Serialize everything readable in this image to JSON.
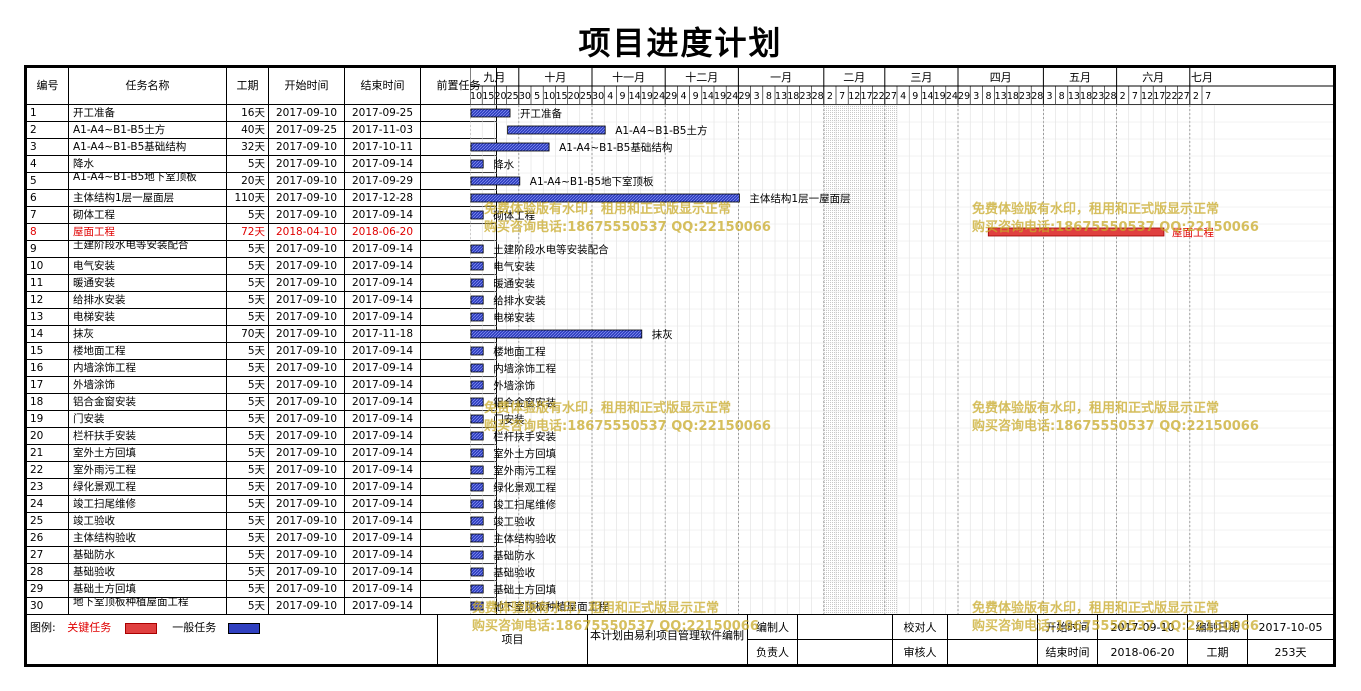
{
  "title": "项目进度计划",
  "headers": {
    "id": "编号",
    "name": "任务名称",
    "duration": "工期",
    "start": "开始时间",
    "end": "结束时间",
    "predecessor": "前置任务"
  },
  "colors": {
    "critical": "#e04040",
    "normal": "#3040c0",
    "critical_text": "#e00000"
  },
  "timeline": {
    "origin": "2017-09-10",
    "months": [
      {
        "label": "九月",
        "days": [
          "10",
          "15",
          "20",
          "25"
        ]
      },
      {
        "label": "十月",
        "days": [
          "30",
          "5",
          "10",
          "15",
          "20",
          "25"
        ]
      },
      {
        "label": "十一月",
        "days": [
          "30",
          "4",
          "9",
          "14",
          "19",
          "24"
        ]
      },
      {
        "label": "十二月",
        "days": [
          "29",
          "4",
          "9",
          "14",
          "19",
          "24"
        ]
      },
      {
        "label": "一月",
        "days": [
          "29",
          "3",
          "8",
          "13",
          "18",
          "23",
          "28"
        ]
      },
      {
        "label": "二月",
        "days": [
          "2",
          "7",
          "12",
          "17",
          "22"
        ]
      },
      {
        "label": "三月",
        "days": [
          "27",
          "4",
          "9",
          "14",
          "19",
          "24"
        ]
      },
      {
        "label": "四月",
        "days": [
          "29",
          "3",
          "8",
          "13",
          "18",
          "23",
          "28"
        ]
      },
      {
        "label": "五月",
        "days": [
          "3",
          "8",
          "13",
          "18",
          "23",
          "28"
        ]
      },
      {
        "label": "六月",
        "days": [
          "2",
          "7",
          "12",
          "17",
          "22",
          "27"
        ]
      },
      {
        "label": "七月",
        "days": [
          "2",
          "7"
        ]
      }
    ]
  },
  "tasks": [
    {
      "id": "1",
      "name": "开工准备",
      "duration": "16天",
      "start": "2017-09-10",
      "end": "2017-09-25",
      "bar_label": "开工准备",
      "critical": false,
      "two_line": false
    },
    {
      "id": "2",
      "name": "A1-A4~B1-B5土方",
      "duration": "40天",
      "start": "2017-09-25",
      "end": "2017-11-03",
      "bar_label": "A1-A4~B1-B5土方",
      "critical": false,
      "two_line": false
    },
    {
      "id": "3",
      "name": "A1-A4~B1-B5基础结构",
      "duration": "32天",
      "start": "2017-09-10",
      "end": "2017-10-11",
      "bar_label": "A1-A4~B1-B5基础结构",
      "critical": false,
      "two_line": false
    },
    {
      "id": "4",
      "name": "降水",
      "duration": "5天",
      "start": "2017-09-10",
      "end": "2017-09-14",
      "bar_label": "降水",
      "critical": false,
      "two_line": false
    },
    {
      "id": "5",
      "name": "A1-A4~B1-B5地下室顶板",
      "duration": "20天",
      "start": "2017-09-10",
      "end": "2017-09-29",
      "bar_label": "A1-A4~B1-B5地下室顶板",
      "critical": false,
      "two_line": true
    },
    {
      "id": "6",
      "name": "主体结构1层一屋面层",
      "duration": "110天",
      "start": "2017-09-10",
      "end": "2017-12-28",
      "bar_label": "主体结构1层一屋面层",
      "critical": false,
      "two_line": false
    },
    {
      "id": "7",
      "name": "砌体工程",
      "duration": "5天",
      "start": "2017-09-10",
      "end": "2017-09-14",
      "bar_label": "砌体工程",
      "critical": false,
      "two_line": false
    },
    {
      "id": "8",
      "name": "屋面工程",
      "duration": "72天",
      "start": "2018-04-10",
      "end": "2018-06-20",
      "bar_label": "屋面工程",
      "critical": true,
      "two_line": false
    },
    {
      "id": "9",
      "name": "土建阶段水电等安装配合",
      "duration": "5天",
      "start": "2017-09-10",
      "end": "2017-09-14",
      "bar_label": "土建阶段水电等安装配合",
      "critical": false,
      "two_line": true
    },
    {
      "id": "10",
      "name": "电气安装",
      "duration": "5天",
      "start": "2017-09-10",
      "end": "2017-09-14",
      "bar_label": "电气安装",
      "critical": false,
      "two_line": false
    },
    {
      "id": "11",
      "name": "暖通安装",
      "duration": "5天",
      "start": "2017-09-10",
      "end": "2017-09-14",
      "bar_label": "暖通安装",
      "critical": false,
      "two_line": false
    },
    {
      "id": "12",
      "name": "给排水安装",
      "duration": "5天",
      "start": "2017-09-10",
      "end": "2017-09-14",
      "bar_label": "给排水安装",
      "critical": false,
      "two_line": false
    },
    {
      "id": "13",
      "name": "电梯安装",
      "duration": "5天",
      "start": "2017-09-10",
      "end": "2017-09-14",
      "bar_label": "电梯安装",
      "critical": false,
      "two_line": false
    },
    {
      "id": "14",
      "name": "抹灰",
      "duration": "70天",
      "start": "2017-09-10",
      "end": "2017-11-18",
      "bar_label": "抹灰",
      "critical": false,
      "two_line": false
    },
    {
      "id": "15",
      "name": "楼地面工程",
      "duration": "5天",
      "start": "2017-09-10",
      "end": "2017-09-14",
      "bar_label": "楼地面工程",
      "critical": false,
      "two_line": false
    },
    {
      "id": "16",
      "name": "内墙涂饰工程",
      "duration": "5天",
      "start": "2017-09-10",
      "end": "2017-09-14",
      "bar_label": "内墙涂饰工程",
      "critical": false,
      "two_line": false
    },
    {
      "id": "17",
      "name": "外墙涂饰",
      "duration": "5天",
      "start": "2017-09-10",
      "end": "2017-09-14",
      "bar_label": "外墙涂饰",
      "critical": false,
      "two_line": false
    },
    {
      "id": "18",
      "name": "铝合金窗安装",
      "duration": "5天",
      "start": "2017-09-10",
      "end": "2017-09-14",
      "bar_label": "铝合金窗安装",
      "critical": false,
      "two_line": false
    },
    {
      "id": "19",
      "name": "门安装",
      "duration": "5天",
      "start": "2017-09-10",
      "end": "2017-09-14",
      "bar_label": "门安装",
      "critical": false,
      "two_line": false
    },
    {
      "id": "20",
      "name": "栏杆扶手安装",
      "duration": "5天",
      "start": "2017-09-10",
      "end": "2017-09-14",
      "bar_label": "栏杆扶手安装",
      "critical": false,
      "two_line": false
    },
    {
      "id": "21",
      "name": "室外土方回填",
      "duration": "5天",
      "start": "2017-09-10",
      "end": "2017-09-14",
      "bar_label": "室外土方回填",
      "critical": false,
      "two_line": false
    },
    {
      "id": "22",
      "name": "室外雨污工程",
      "duration": "5天",
      "start": "2017-09-10",
      "end": "2017-09-14",
      "bar_label": "室外雨污工程",
      "critical": false,
      "two_line": false
    },
    {
      "id": "23",
      "name": "绿化景观工程",
      "duration": "5天",
      "start": "2017-09-10",
      "end": "2017-09-14",
      "bar_label": "绿化景观工程",
      "critical": false,
      "two_line": false
    },
    {
      "id": "24",
      "name": "竣工扫尾维修",
      "duration": "5天",
      "start": "2017-09-10",
      "end": "2017-09-14",
      "bar_label": "竣工扫尾维修",
      "critical": false,
      "two_line": false
    },
    {
      "id": "25",
      "name": "竣工验收",
      "duration": "5天",
      "start": "2017-09-10",
      "end": "2017-09-14",
      "bar_label": "竣工验收",
      "critical": false,
      "two_line": false
    },
    {
      "id": "26",
      "name": "主体结构验收",
      "duration": "5天",
      "start": "2017-09-10",
      "end": "2017-09-14",
      "bar_label": "主体结构验收",
      "critical": false,
      "two_line": false
    },
    {
      "id": "27",
      "name": "基础防水",
      "duration": "5天",
      "start": "2017-09-10",
      "end": "2017-09-14",
      "bar_label": "基础防水",
      "critical": false,
      "two_line": false
    },
    {
      "id": "28",
      "name": "基础验收",
      "duration": "5天",
      "start": "2017-09-10",
      "end": "2017-09-14",
      "bar_label": "基础验收",
      "critical": false,
      "two_line": false
    },
    {
      "id": "29",
      "name": "基础土方回填",
      "duration": "5天",
      "start": "2017-09-10",
      "end": "2017-09-14",
      "bar_label": "基础土方回填",
      "critical": false,
      "two_line": false
    },
    {
      "id": "30",
      "name": "地下室顶板种植屋面工程",
      "duration": "5天",
      "start": "2017-09-10",
      "end": "2017-09-14",
      "bar_label": "地下室顶板种植屋面工程",
      "critical": false,
      "two_line": true
    }
  ],
  "footer": {
    "legend_label": "图例:",
    "legend_critical": "关键任务",
    "legend_normal": "一般任务",
    "project_label": "项目",
    "software_note": "本计划由易利项目管理软件编制",
    "editor_label": "编制人",
    "editor_value": "",
    "checker_label": "校对人",
    "checker_value": "",
    "owner_label": "负责人",
    "owner_value": "",
    "reviewer_label": "审核人",
    "reviewer_value": "",
    "start_label": "开始时间",
    "start_value": "2017-09-10",
    "date_label": "编制日期",
    "date_value": "2017-10-05",
    "end_label": "结束时间",
    "end_value": "2018-06-20",
    "duration_label": "工期",
    "duration_value": "253天"
  },
  "watermark": {
    "line1": "免费体验版有水印，租用和正式版显示正常",
    "line2": "购买咨询电话:18675550537 QQ:22150066"
  }
}
